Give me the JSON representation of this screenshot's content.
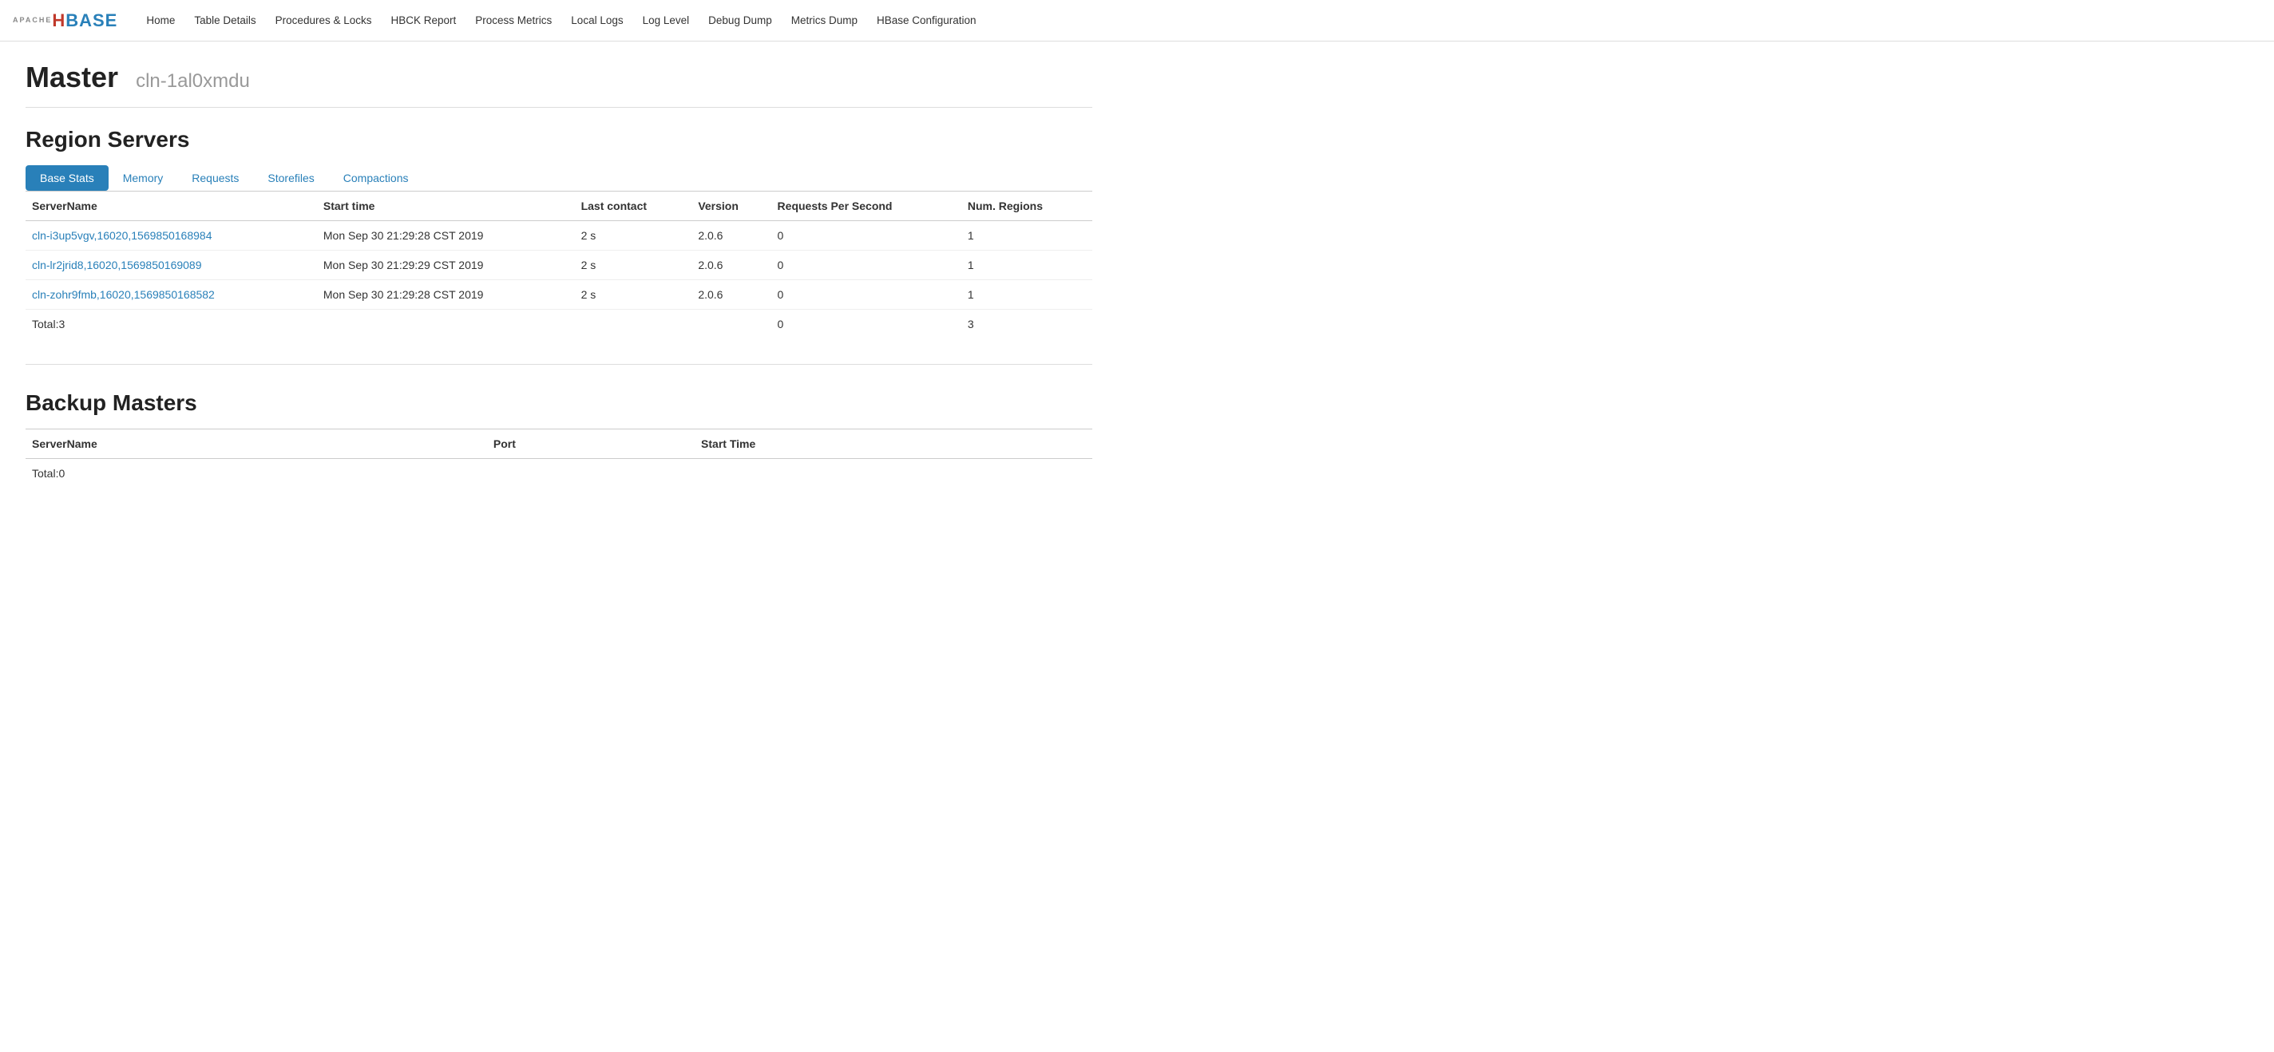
{
  "nav": {
    "logo": {
      "apache": "APACHE",
      "hbase": "HBASE"
    },
    "items": [
      {
        "label": "Home",
        "active": true
      },
      {
        "label": "Table Details",
        "active": false
      },
      {
        "label": "Procedures & Locks",
        "active": false
      },
      {
        "label": "HBCK Report",
        "active": false
      },
      {
        "label": "Process Metrics",
        "active": false
      },
      {
        "label": "Local Logs",
        "active": false
      },
      {
        "label": "Log Level",
        "active": false
      },
      {
        "label": "Debug Dump",
        "active": false
      },
      {
        "label": "Metrics Dump",
        "active": false
      },
      {
        "label": "HBase Configuration",
        "active": false
      }
    ]
  },
  "master": {
    "title": "Master",
    "hostname": "cln-1al0xmdu"
  },
  "region_servers": {
    "section_title": "Region Servers",
    "tabs": [
      {
        "label": "Base Stats",
        "active": true
      },
      {
        "label": "Memory",
        "active": false
      },
      {
        "label": "Requests",
        "active": false
      },
      {
        "label": "Storefiles",
        "active": false
      },
      {
        "label": "Compactions",
        "active": false
      }
    ],
    "columns": [
      "ServerName",
      "Start time",
      "Last contact",
      "Version",
      "Requests Per Second",
      "Num. Regions"
    ],
    "rows": [
      {
        "server_name": "cln-i3up5vgv,16020,1569850168984",
        "start_time": "Mon Sep 30 21:29:28 CST 2019",
        "last_contact": "2 s",
        "version": "2.0.6",
        "rps": "0",
        "num_regions": "1"
      },
      {
        "server_name": "cln-lr2jrid8,16020,1569850169089",
        "start_time": "Mon Sep 30 21:29:29 CST 2019",
        "last_contact": "2 s",
        "version": "2.0.6",
        "rps": "0",
        "num_regions": "1"
      },
      {
        "server_name": "cln-zohr9fmb,16020,1569850168582",
        "start_time": "Mon Sep 30 21:29:28 CST 2019",
        "last_contact": "2 s",
        "version": "2.0.6",
        "rps": "0",
        "num_regions": "1"
      }
    ],
    "total_label": "Total:3",
    "total_rps": "0",
    "total_regions": "3"
  },
  "backup_masters": {
    "section_title": "Backup Masters",
    "columns": [
      "ServerName",
      "Port",
      "Start Time"
    ],
    "total_label": "Total:0"
  }
}
